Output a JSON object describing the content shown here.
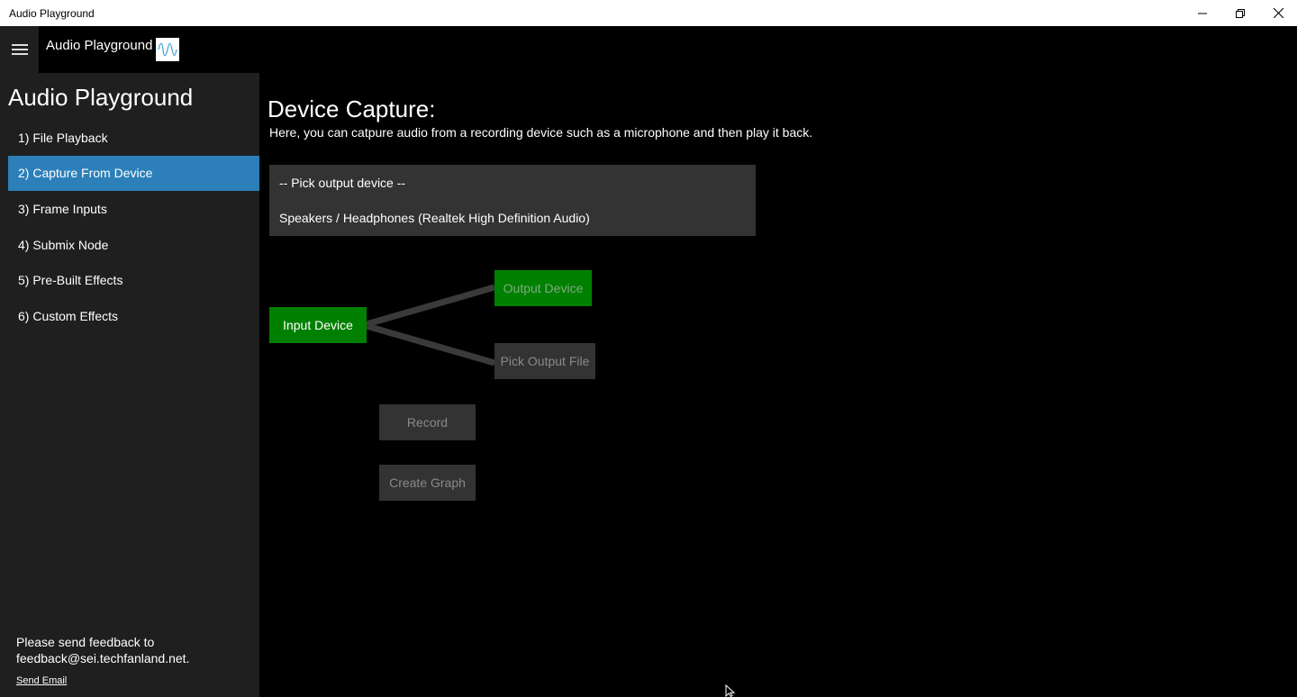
{
  "window": {
    "title": "Audio Playground",
    "minimize_glyph": "—",
    "restore_glyph": "❐",
    "close_glyph": "✕"
  },
  "header": {
    "app_title": "Audio Playground",
    "icon": "waveform-icon"
  },
  "sidebar": {
    "heading": "Audio Playground",
    "items": [
      {
        "label": "1) File Playback"
      },
      {
        "label": "2) Capture From Device",
        "active": true
      },
      {
        "label": "3) Frame Inputs"
      },
      {
        "label": "4) Submix Node"
      },
      {
        "label": "5) Pre-Built Effects"
      },
      {
        "label": "6) Custom Effects"
      }
    ],
    "feedback_line1": "Please send feedback to",
    "feedback_line2": "feedback@sei.techfanland.net.",
    "send_email": "Send Email"
  },
  "main": {
    "title": "Device Capture:",
    "description": "Here, you can catpure audio from a recording device such as a microphone and then play it back.",
    "device_options": [
      "-- Pick output device --",
      "Speakers / Headphones (Realtek High Definition Audio)"
    ],
    "buttons": {
      "input_device": "Input Device",
      "output_device": "Output Device",
      "pick_output_file": "Pick Output File",
      "record": "Record",
      "create_graph": "Create Graph"
    }
  },
  "colors": {
    "accent": "#2c7fb8",
    "node_green": "#008000",
    "disabled_bg": "#333333",
    "sidebar_bg": "#1f1f1f"
  }
}
